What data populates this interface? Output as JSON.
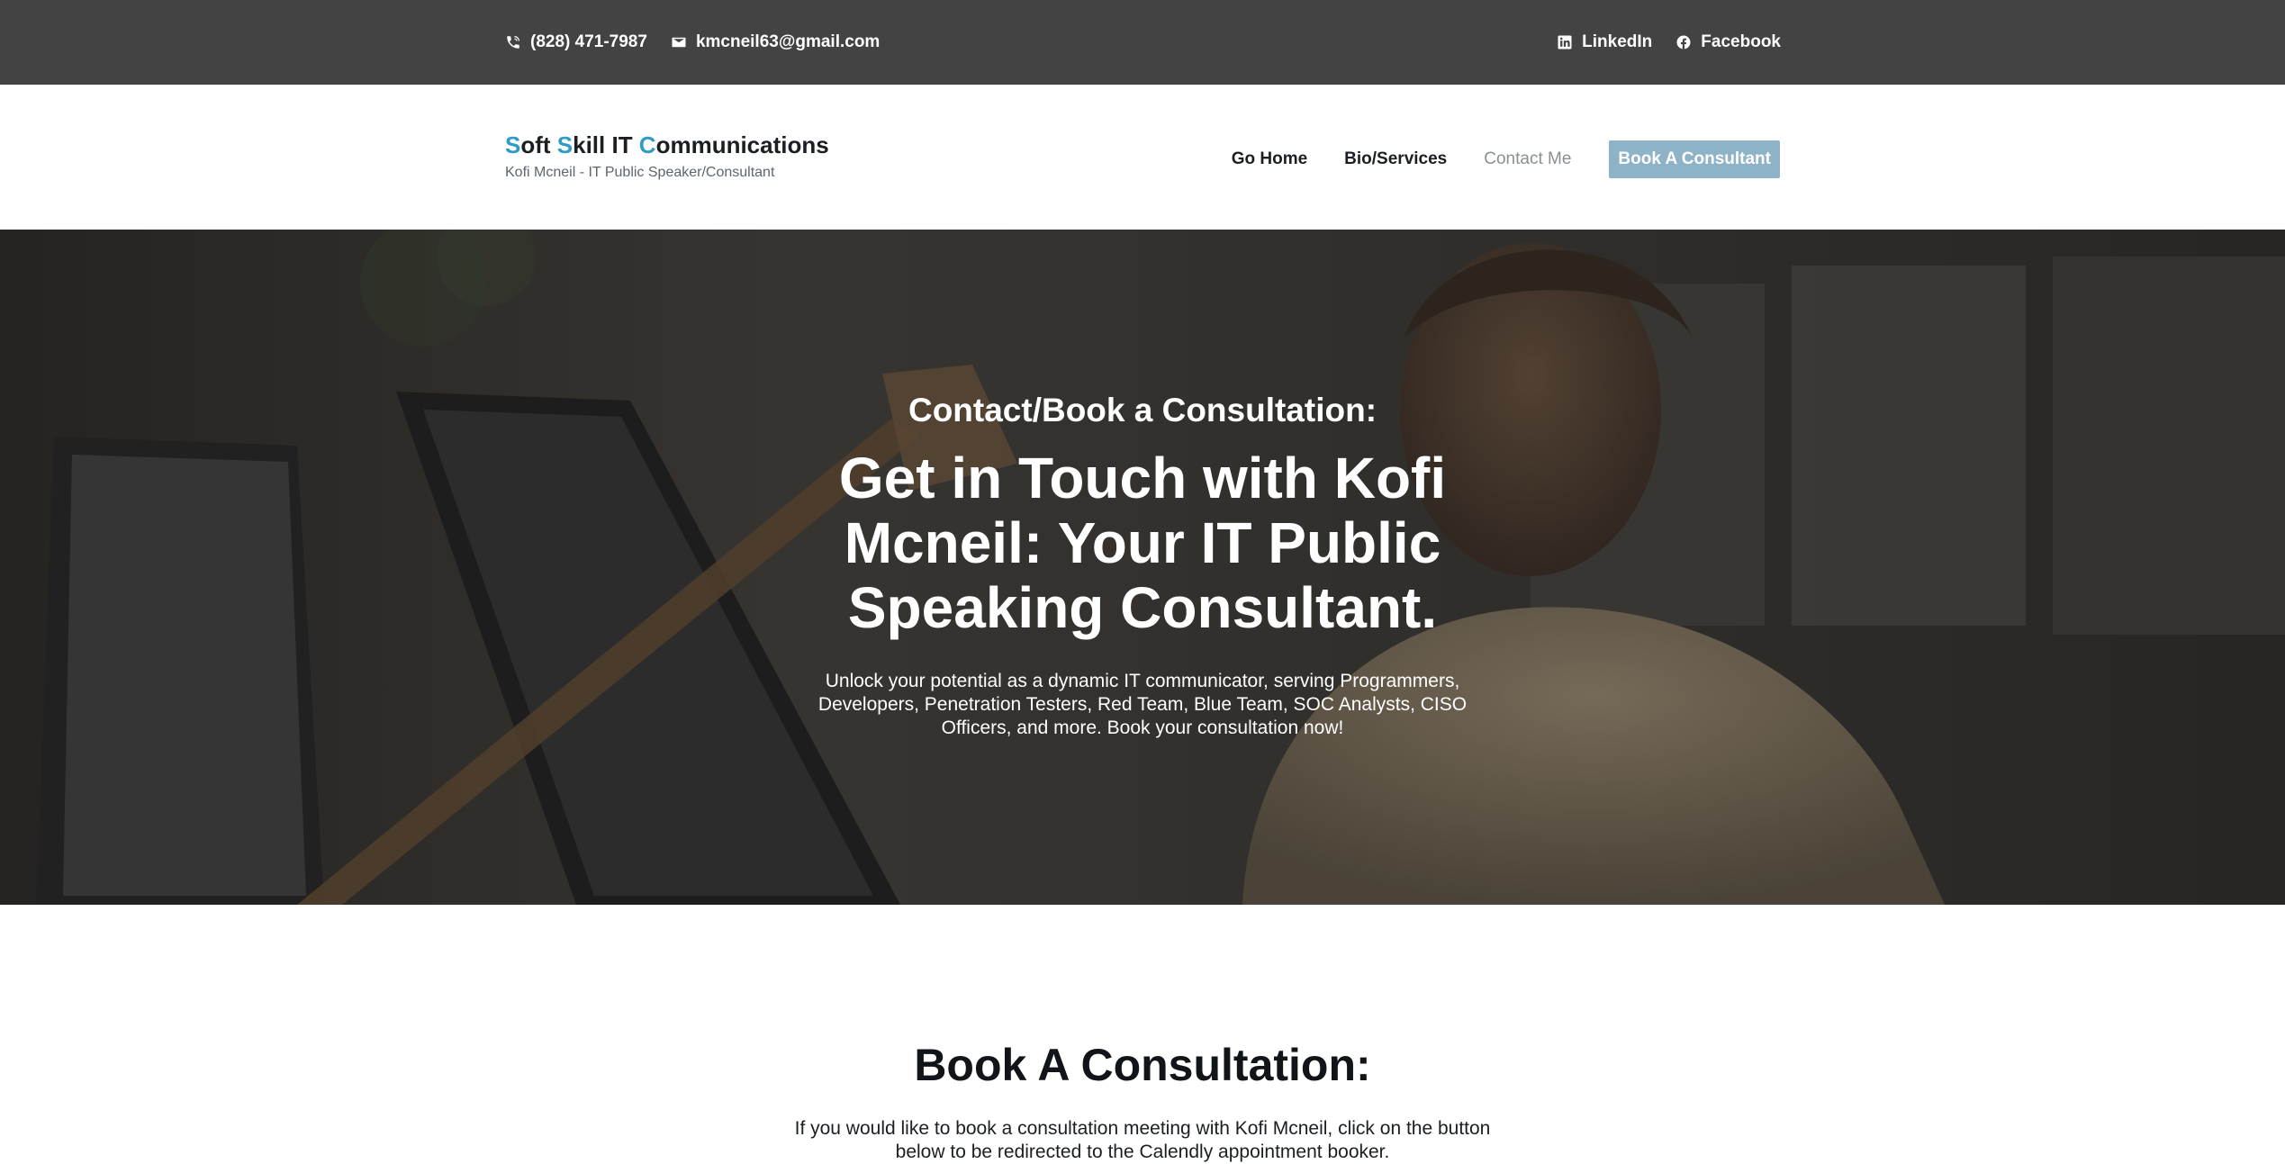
{
  "topbar": {
    "phone": "(828) 471-7987",
    "email": "kmcneil63@gmail.com",
    "linkedin": "LinkedIn",
    "facebook": "Facebook"
  },
  "brand": {
    "title_parts": [
      "S",
      "oft ",
      "S",
      "kill IT ",
      "C",
      "ommunications"
    ],
    "subtitle": "Kofi Mcneil - IT Public Speaker/Consultant",
    "accent_color": "#2f9cc7"
  },
  "nav": {
    "items": [
      {
        "label": "Go Home",
        "active": false
      },
      {
        "label": "Bio/Services",
        "active": false
      },
      {
        "label": "Contact Me",
        "active": true
      }
    ],
    "cta": "Book A Consultant",
    "cta_color": "#8fb3c6"
  },
  "hero": {
    "kicker": "Contact/Book a Consultation:",
    "title": "Get in Touch with Kofi Mcneil: Your IT Public Speaking Consultant.",
    "text": "Unlock your potential as a dynamic IT communicator, serving Programmers, Developers, Penetration Testers, Red Team, Blue Team, SOC Analysts, CISO Officers, and more. Book your consultation now!"
  },
  "consult": {
    "title": "Book A Consultation:",
    "text": "If you would like to book a consultation meeting with Kofi Mcneil, click on the button below to be redirected to the Calendly appointment booker."
  },
  "colors": {
    "topbar_bg": "#434343",
    "hero_overlay": "#2c2b28"
  },
  "icons": {
    "phone": "phone-icon",
    "email": "mail-icon",
    "linkedin": "linkedin-icon",
    "facebook": "facebook-icon"
  }
}
